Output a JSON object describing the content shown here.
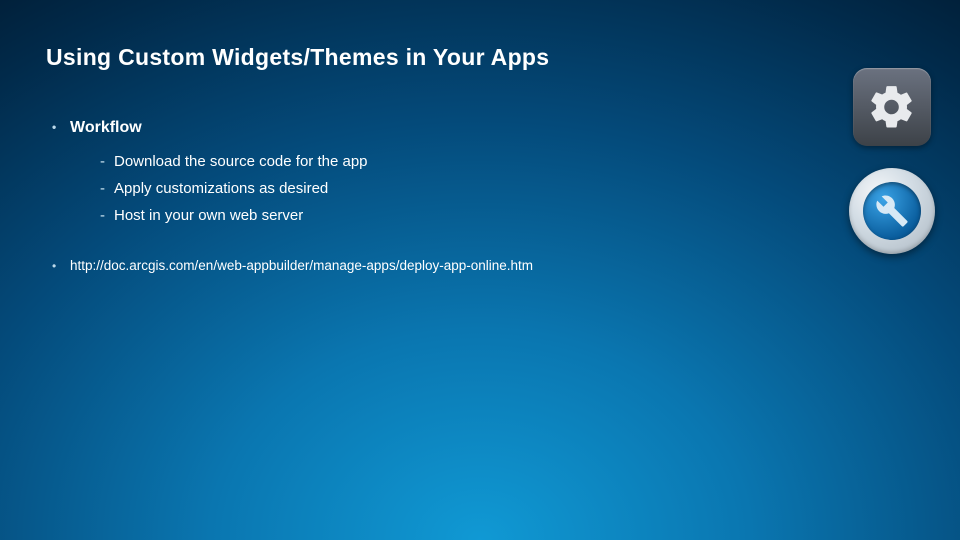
{
  "title": "Using Custom Widgets/Themes in Your Apps",
  "workflow": {
    "heading": "Workflow",
    "items": [
      "Download the source code for the app",
      "Apply customizations as desired",
      "Host in your own web server"
    ]
  },
  "link": "http://doc.arcgis.com/en/web-appbuilder/manage-apps/deploy-app-online.htm",
  "icons": {
    "gear": "gear-icon",
    "wrench": "wrench-icon"
  }
}
